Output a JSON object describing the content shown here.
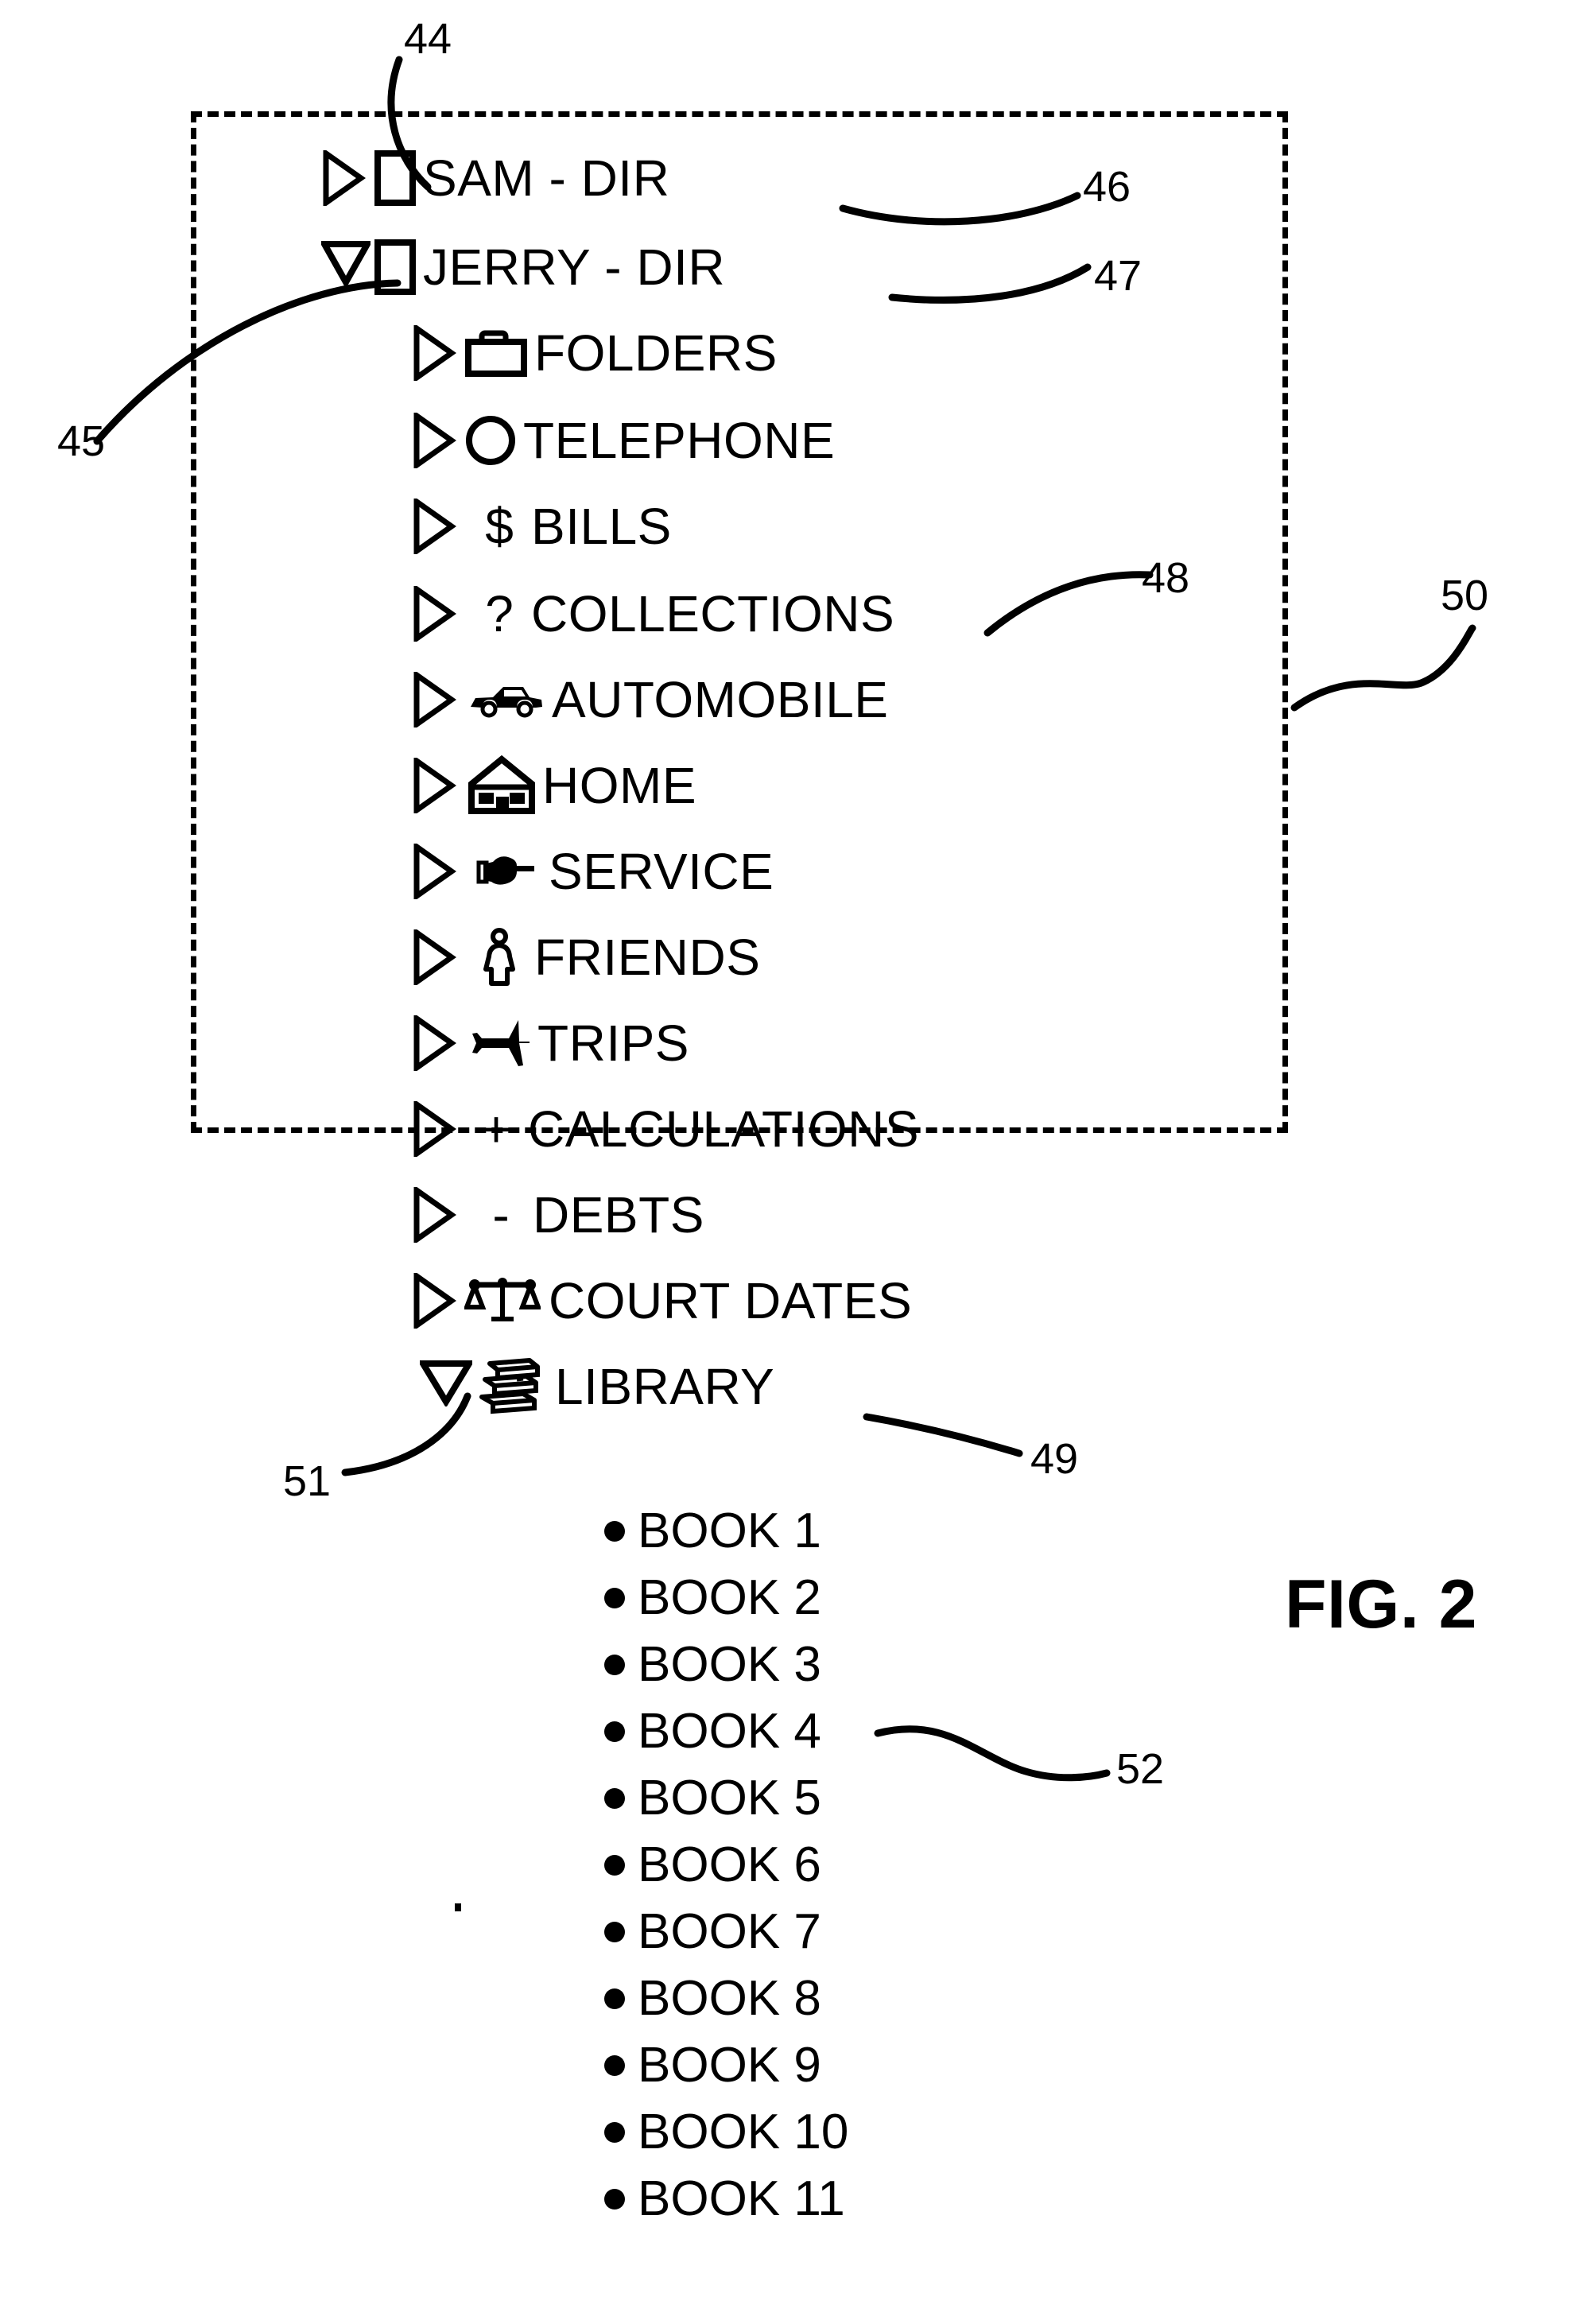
{
  "figure": {
    "caption": "FIG. 2"
  },
  "tree": {
    "roots": [
      {
        "label": "SAM - DIR",
        "disclosure": "collapsed",
        "icon": "document-square-icon",
        "callout": "46"
      },
      {
        "label": "JERRY - DIR",
        "disclosure": "expanded",
        "icon": "document-square-icon",
        "callout": "47"
      }
    ],
    "children": [
      {
        "label": "FOLDERS",
        "disclosure": "collapsed",
        "icon": "folder-icon"
      },
      {
        "label": "TELEPHONE",
        "disclosure": "collapsed",
        "icon": "circle-icon"
      },
      {
        "label": "BILLS",
        "disclosure": "collapsed",
        "icon": "dollar-sign-icon",
        "glyph": "$"
      },
      {
        "label": "COLLECTIONS",
        "disclosure": "collapsed",
        "icon": "question-mark-icon",
        "glyph": "?",
        "callout": "48"
      },
      {
        "label": "AUTOMOBILE",
        "disclosure": "collapsed",
        "icon": "car-icon"
      },
      {
        "label": "HOME",
        "disclosure": "collapsed",
        "icon": "house-icon"
      },
      {
        "label": "SERVICE",
        "disclosure": "collapsed",
        "icon": "pointing-hand-icon"
      },
      {
        "label": "FRIENDS",
        "disclosure": "collapsed",
        "icon": "person-icon"
      },
      {
        "label": "TRIPS",
        "disclosure": "collapsed",
        "icon": "airplane-icon"
      },
      {
        "label": "CALCULATIONS",
        "disclosure": "collapsed",
        "icon": "plus-sign-icon",
        "glyph": "+"
      },
      {
        "label": "DEBTS",
        "disclosure": "collapsed",
        "icon": "minus-sign-icon",
        "glyph": "-"
      },
      {
        "label": "COURT DATES",
        "disclosure": "collapsed",
        "icon": "scales-of-justice-icon"
      },
      {
        "label": "LIBRARY",
        "disclosure": "expanded",
        "icon": "books-stack-icon",
        "callout": "49"
      }
    ],
    "library_books": [
      {
        "label": "BOOK 1"
      },
      {
        "label": "BOOK 2"
      },
      {
        "label": "BOOK 3"
      },
      {
        "label": "BOOK 4",
        "callout": "52"
      },
      {
        "label": "BOOK 5"
      },
      {
        "label": "BOOK 6"
      },
      {
        "label": "BOOK 7"
      },
      {
        "label": "BOOK 8"
      },
      {
        "label": "BOOK 9"
      },
      {
        "label": "BOOK 10"
      },
      {
        "label": "BOOK 11"
      }
    ]
  },
  "callouts": {
    "c44": "44",
    "c45": "45",
    "c46": "46",
    "c47": "47",
    "c48": "48",
    "c49": "49",
    "c50": "50",
    "c51": "51",
    "c52": "52"
  },
  "colors": {
    "ink": "#000000",
    "background": "#ffffff"
  }
}
